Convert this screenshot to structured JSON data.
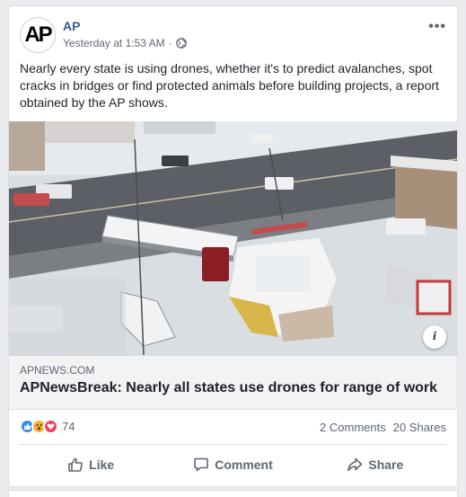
{
  "post": {
    "page_name": "AP",
    "avatar_text": "AP",
    "timestamp": "Yesterday at 1:53 AM",
    "meta_separator": "·",
    "privacy_icon": "globe-icon",
    "more_icon": "more-options-icon",
    "more_text": "•••",
    "caption": "Nearly every state is using drones, whether it's to predict avalanches, spot cracks in bridges or find protected animals before building projects, a report obtained by the AP shows."
  },
  "link_preview": {
    "domain": "APNEWS.COM",
    "title": "APNewsBreak: Nearly all states use drones for range of work",
    "info_text": "i",
    "photo_alt": "Aerial view of a tractor-trailer crashed into a snow-covered building with fire trucks nearby"
  },
  "stats": {
    "reaction_icons": [
      "like-reaction-icon",
      "wow-reaction-icon",
      "love-reaction-icon"
    ],
    "reaction_count": "74",
    "comments": "2 Comments",
    "shares": "20 Shares"
  },
  "actions": {
    "like": "Like",
    "comment": "Comment",
    "share": "Share"
  },
  "colors": {
    "page_name": "#385898",
    "background": "#e9ebee",
    "link_box": "#f2f3f5",
    "like_reaction": "#2d88ff",
    "love_reaction": "#f33e58",
    "wow_reaction": "#f7b125"
  }
}
